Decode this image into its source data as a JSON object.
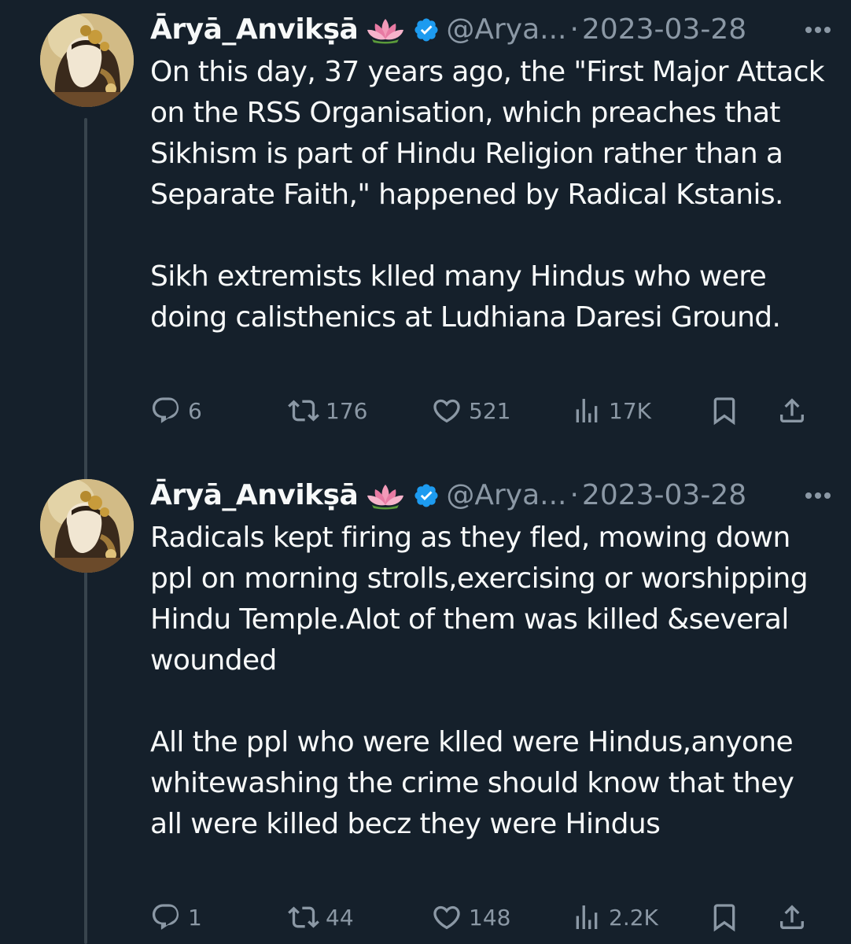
{
  "tweets": [
    {
      "display_name": "Āryā_Anvikṣā",
      "handle": "@Arya...",
      "separator": "·",
      "date": "2023-03-28",
      "text": "On this day, 37 years ago, the \"First Major Attack on the RSS Organisation, which preaches that Sikhism is part of Hindu Religion rather than a Separate Faith,\" happened by Radical Kstanis.\n\nSikh extremists klled many Hindus who were doing calisthenics at Ludhiana Daresi Ground.",
      "stats": {
        "replies": "6",
        "reposts": "176",
        "likes": "521",
        "views": "17K"
      }
    },
    {
      "display_name": "Āryā_Anvikṣā",
      "handle": "@Arya...",
      "separator": "·",
      "date": "2023-03-28",
      "text": "Radicals kept firing as they fled, mowing down ppl on morning strolls,exercising or worshipping Hindu Temple.Alot of them was killed &several wounded\n\nAll the ppl who were klled were Hindus,anyone whitewashing the crime should know that they all were killed becz they were Hindus",
      "stats": {
        "replies": "1",
        "reposts": "44",
        "likes": "148",
        "views": "2.2K"
      }
    }
  ],
  "icons": {
    "more": "more-horizontal-icon",
    "verified": "verified-badge-icon",
    "emoji": "lotus-emoji",
    "reply": "reply-icon",
    "repost": "repost-icon",
    "like": "heart-icon",
    "views": "views-bar-chart-icon",
    "bookmark": "bookmark-icon",
    "share": "share-icon"
  },
  "colors": {
    "background": "#15202b",
    "text_primary": "#f7f9f9",
    "text_secondary": "#8b98a5",
    "verified_blue": "#1d9bf0",
    "thread_line": "#38444d"
  }
}
